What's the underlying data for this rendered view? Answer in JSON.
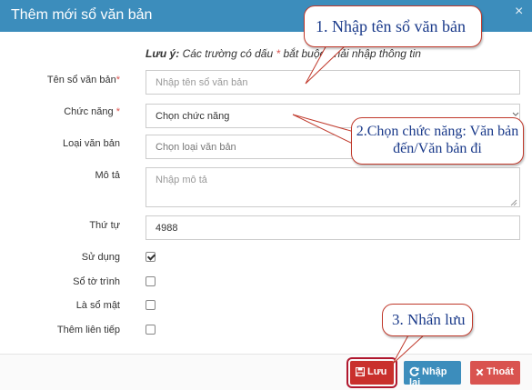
{
  "dialog": {
    "title": "Thêm mới sổ văn bản",
    "close_symbol": "×"
  },
  "note": {
    "prefix": "Lưu ý:",
    "text_before_star": " Các trường có dấu ",
    "star": "*",
    "text_after_star": " bắt buộc phải nhập thông tin"
  },
  "fields": {
    "ten_so": {
      "label": "Tên sổ văn bản",
      "required_mark": "*",
      "placeholder": "Nhập tên sổ văn bản",
      "value": ""
    },
    "chuc_nang": {
      "label": "Chức năng",
      "required_mark": "*",
      "selected": "Chọn chức năng"
    },
    "loai_van_ban": {
      "label": "Loại văn bản",
      "selected": "Chọn loại văn bản"
    },
    "mo_ta": {
      "label": "Mô tả",
      "placeholder": "Nhập mô tả",
      "value": ""
    },
    "thu_tu": {
      "label": "Thứ tự",
      "value": "4988"
    },
    "su_dung": {
      "label": "Sử dụng",
      "checked": true
    },
    "so_to_trinh": {
      "label": "Sổ tờ trình",
      "checked": false
    },
    "la_so_mat": {
      "label": "Là sổ mật",
      "checked": false
    },
    "them_lien_tiep": {
      "label": "Thêm liên tiếp",
      "checked": false
    }
  },
  "buttons": {
    "save": {
      "label": "Lưu",
      "icon": "save-icon"
    },
    "reset": {
      "label": "Nhập lại",
      "icon": "refresh-icon"
    },
    "exit": {
      "label": "Thoát",
      "icon": "close-icon"
    }
  },
  "callouts": {
    "step1": "1. Nhập tên sổ văn bản",
    "step2": "2.Chọn chức năng: Văn bản đến/Văn bản đi",
    "step3": "3. Nhấn lưu"
  },
  "colors": {
    "header": "#3c8dbc",
    "save_button": "#c9302c",
    "reset_button": "#3c8dbc",
    "exit_button": "#d9534f",
    "required": "#d9534f",
    "callout_border": "#c0392b",
    "callout_text": "#1a3a8a"
  }
}
